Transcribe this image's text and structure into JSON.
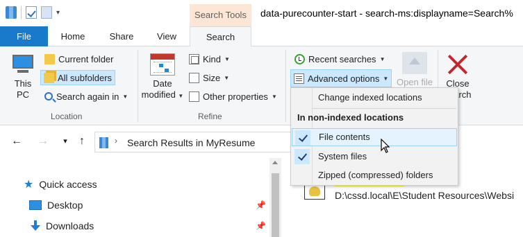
{
  "titlebar": {
    "context_tab": "Search Tools",
    "window_title": "data-purecounter-start - search-ms:displayname=Search%"
  },
  "tabs": {
    "file": "File",
    "home": "Home",
    "share": "Share",
    "view": "View",
    "search": "Search"
  },
  "ribbon": {
    "location": {
      "label": "Location",
      "this_pc": "This PC",
      "current_folder": "Current folder",
      "all_subfolders": "All subfolders",
      "search_again": "Search again in"
    },
    "refine": {
      "label": "Refine",
      "date_modified": "Date modified",
      "kind": "Kind",
      "size": "Size",
      "other_properties": "Other properties"
    },
    "options": {
      "recent_searches": "Recent searches",
      "advanced_options": "Advanced options",
      "open_file": "Open file",
      "close_search": "Close search"
    }
  },
  "advanced_menu": {
    "change_indexed": "Change indexed locations",
    "heading": "In non-indexed locations",
    "items": [
      {
        "label": "File contents",
        "checked": true
      },
      {
        "label": "System files",
        "checked": true
      },
      {
        "label": "Zipped (compressed) folders",
        "checked": false
      }
    ]
  },
  "address": {
    "crumb": "Search Results in MyResume"
  },
  "navpane": {
    "quick_access": "Quick access",
    "items": [
      "Desktop",
      "Downloads"
    ]
  },
  "results": {
    "path": "D:\\cssd.local\\E\\Student Resources\\Websi"
  },
  "colors": {
    "file_tab": "#1979ca",
    "context_tab": "#fde6d5",
    "selection": "#cce8ff",
    "close_x": "#c0282d",
    "highlight": "#ffff30"
  }
}
